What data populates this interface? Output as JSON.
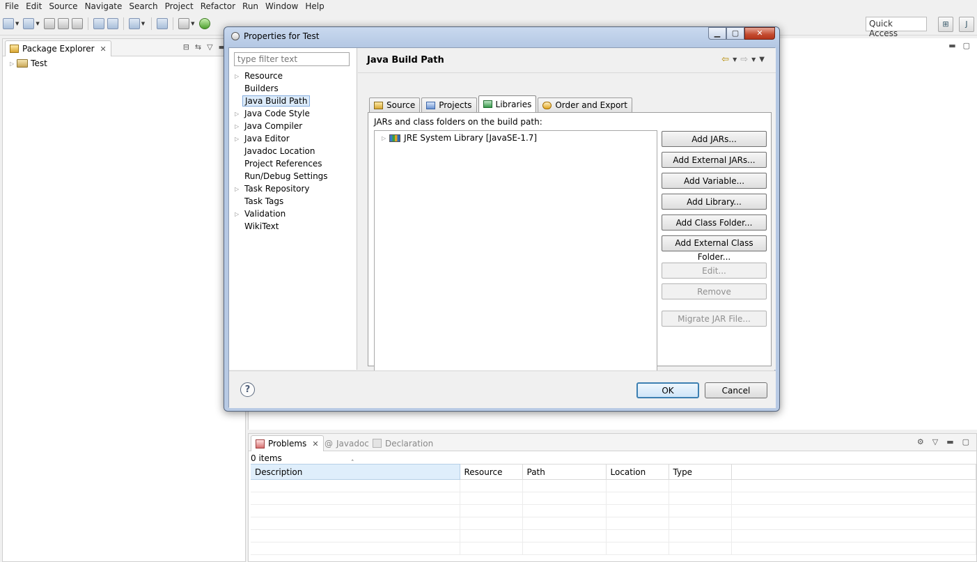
{
  "menu": [
    "File",
    "Edit",
    "Source",
    "Navigate",
    "Search",
    "Project",
    "Refactor",
    "Run",
    "Window",
    "Help"
  ],
  "toolbar": {
    "quick_access_label": "Quick Access"
  },
  "package_explorer": {
    "tab_label": "Package Explorer",
    "tree": [
      {
        "label": "Test"
      }
    ]
  },
  "problems": {
    "tabs": [
      "Problems",
      "Javadoc",
      "Declaration"
    ],
    "count_text": "0 items",
    "columns": [
      "Description",
      "Resource",
      "Path",
      "Location",
      "Type"
    ]
  },
  "dialog": {
    "title": "Properties for Test",
    "filter_placeholder": "type filter text",
    "categories": [
      {
        "label": "Resource",
        "expandable": true
      },
      {
        "label": "Builders",
        "expandable": false
      },
      {
        "label": "Java Build Path",
        "expandable": false,
        "selected": true
      },
      {
        "label": "Java Code Style",
        "expandable": true
      },
      {
        "label": "Java Compiler",
        "expandable": true
      },
      {
        "label": "Java Editor",
        "expandable": true
      },
      {
        "label": "Javadoc Location",
        "expandable": false
      },
      {
        "label": "Project References",
        "expandable": false
      },
      {
        "label": "Run/Debug Settings",
        "expandable": false
      },
      {
        "label": "Task Repository",
        "expandable": true
      },
      {
        "label": "Task Tags",
        "expandable": false
      },
      {
        "label": "Validation",
        "expandable": true
      },
      {
        "label": "WikiText",
        "expandable": false
      }
    ],
    "page_title": "Java Build Path",
    "tabs": [
      "Source",
      "Projects",
      "Libraries",
      "Order and Export"
    ],
    "active_tab": "Libraries",
    "libraries": {
      "label": "JARs and class folders on the build path:",
      "entries": [
        "JRE System Library [JavaSE-1.7]"
      ],
      "buttons": {
        "add_jars": "Add JARs...",
        "add_external_jars": "Add External JARs...",
        "add_variable": "Add Variable...",
        "add_library": "Add Library...",
        "add_class_folder": "Add Class Folder...",
        "add_external_class_folder": "Add External Class Folder...",
        "edit": "Edit...",
        "remove": "Remove",
        "migrate_jar": "Migrate JAR File..."
      }
    },
    "ok_label": "OK",
    "cancel_label": "Cancel",
    "help_glyph": "?"
  }
}
